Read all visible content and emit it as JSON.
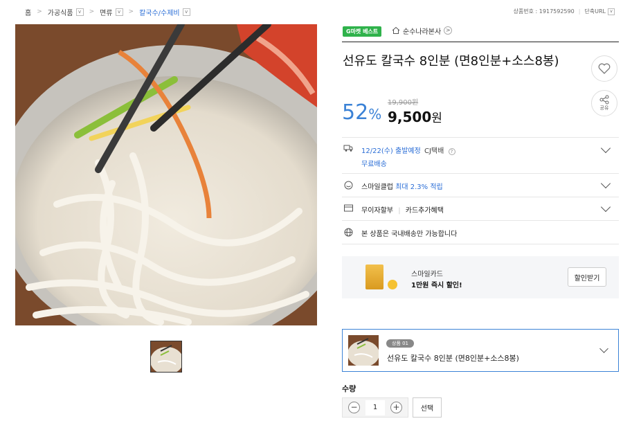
{
  "breadcrumb": {
    "items": [
      "홈",
      "가공식품",
      "면류",
      "칼국수/수제비"
    ]
  },
  "product_number": "상품번호 : 1917592590",
  "short_url": "단축URL",
  "badge": "G마켓 베스트",
  "seller": "순수나라본사",
  "title": "선유도 칼국수 8인분 (면8인분+소스8봉)",
  "share_label": "공유",
  "price": {
    "discount": "52",
    "discount_unit": "%",
    "original": "19,900원",
    "sale": "9,500",
    "sale_unit": "원"
  },
  "rows": [
    {
      "text": "12/22(수) 출발예정",
      "extra": "CJ택배",
      "sub": "무료배송",
      "icon": "truck-icon"
    },
    {
      "text": "스마일클럽",
      "highlight": "최대 2.3% 적립",
      "icon": "smile-icon"
    },
    {
      "text": "무이자할부",
      "extra": "카드추가혜택",
      "icon": "card-icon"
    },
    {
      "text": "본 상품은 국내배송만 가능합니다",
      "icon": "globe-icon"
    }
  ],
  "smilecard": {
    "line1": "스마일카드",
    "line2": "1만원 즉시 할인!",
    "button": "할인받기"
  },
  "option": {
    "badge": "상품 01",
    "label": "선유도 칼국수 8인분 (면8인분+소스8봉)"
  },
  "quantity": {
    "label": "수량",
    "value": "1",
    "minus": "−",
    "plus": "+",
    "select_button": "선택"
  },
  "colors": {
    "accent": "#3b82d6",
    "badge_green": "#2fb24b"
  }
}
